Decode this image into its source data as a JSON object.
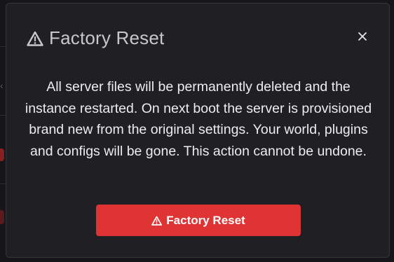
{
  "modal": {
    "title": "Factory Reset",
    "title_icon": "warning-triangle-icon",
    "close_icon": "close-icon",
    "close_glyph": "×",
    "message": "All server files will be permanently deleted and the instance restarted. On next boot the server is provisioned brand new from the original settings. Your world, plugins and configs will be gone. This action cannot be undone.",
    "confirm_button": {
      "label": "Factory Reset",
      "icon": "warning-triangle-icon",
      "color": "#e03333"
    }
  },
  "colors": {
    "modal_background": "#1f1f24",
    "title_text": "#c8c8cc",
    "body_text": "#ededef",
    "danger": "#e03333"
  }
}
